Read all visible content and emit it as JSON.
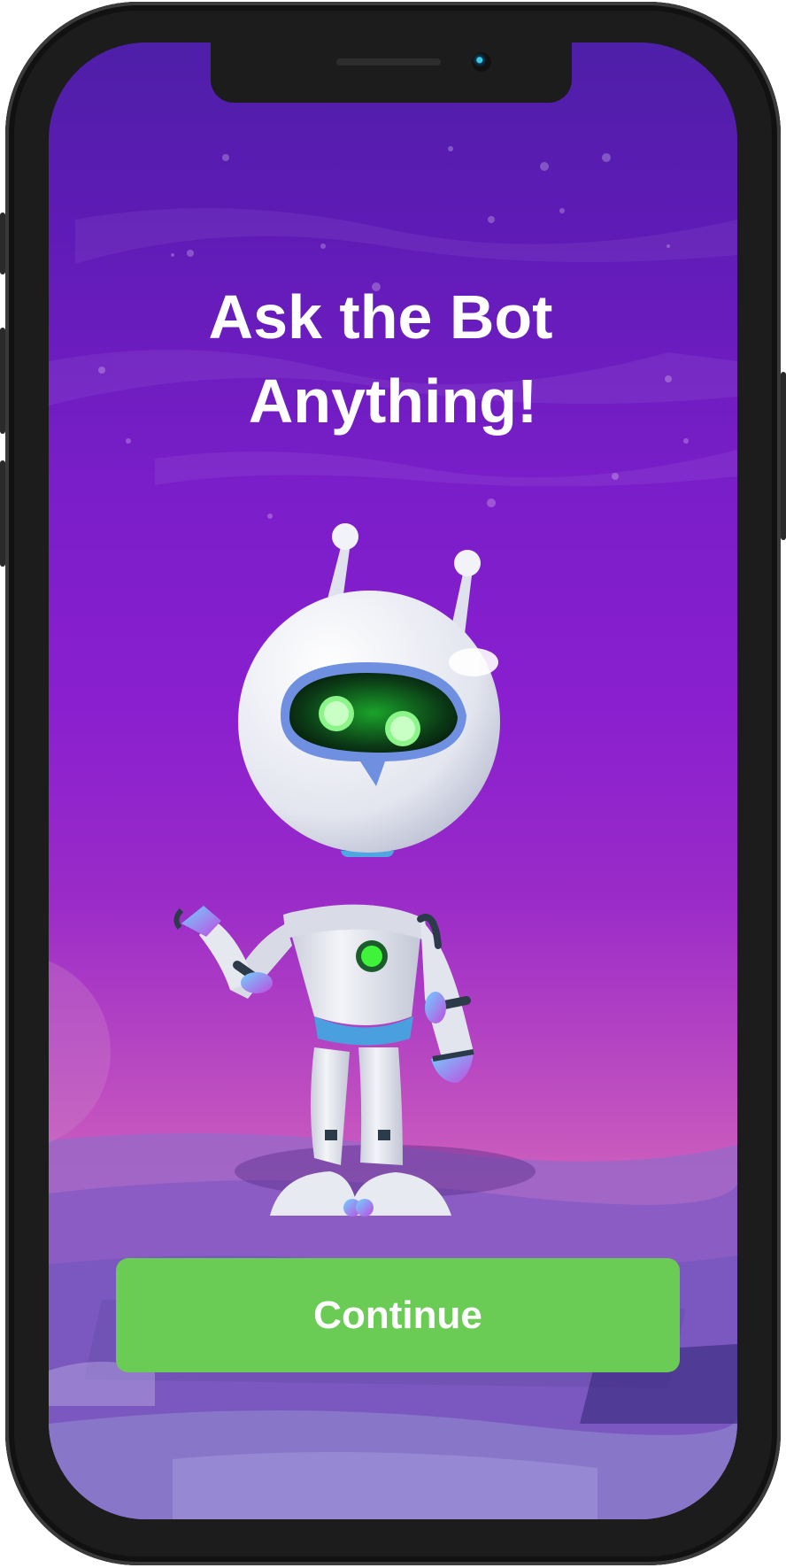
{
  "screen": {
    "title_line1": "Ask the Bot",
    "title_line2": "Anything!",
    "continue_label": "Continue"
  },
  "illustration": {
    "character": "robot-mascot",
    "eye_color": "#3ff23a"
  },
  "colors": {
    "background_top": "#4e1fa8",
    "background_mid": "#8a1fcf",
    "background_horizon": "#d468bb",
    "button": "#6acc55",
    "text": "#ffffff"
  }
}
